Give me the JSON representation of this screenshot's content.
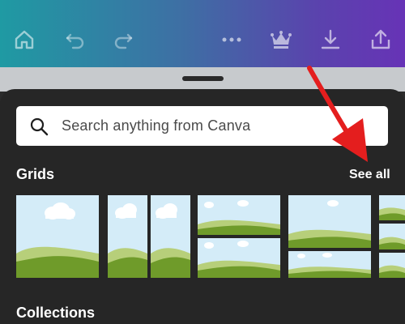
{
  "toolbar": {
    "icons": [
      "home-icon",
      "undo-icon",
      "redo-icon",
      "more-icon",
      "crown-icon",
      "download-icon",
      "share-icon"
    ]
  },
  "search": {
    "placeholder": "Search anything from Canva"
  },
  "sections": {
    "grids": {
      "title": "Grids",
      "see_all": "See all"
    },
    "collections": {
      "title": "Collections"
    }
  },
  "colors": {
    "gradient_start": "#1f9aa3",
    "gradient_end": "#6733b6",
    "sheet_bg": "#262626",
    "annotation_arrow": "#e41e1e"
  }
}
